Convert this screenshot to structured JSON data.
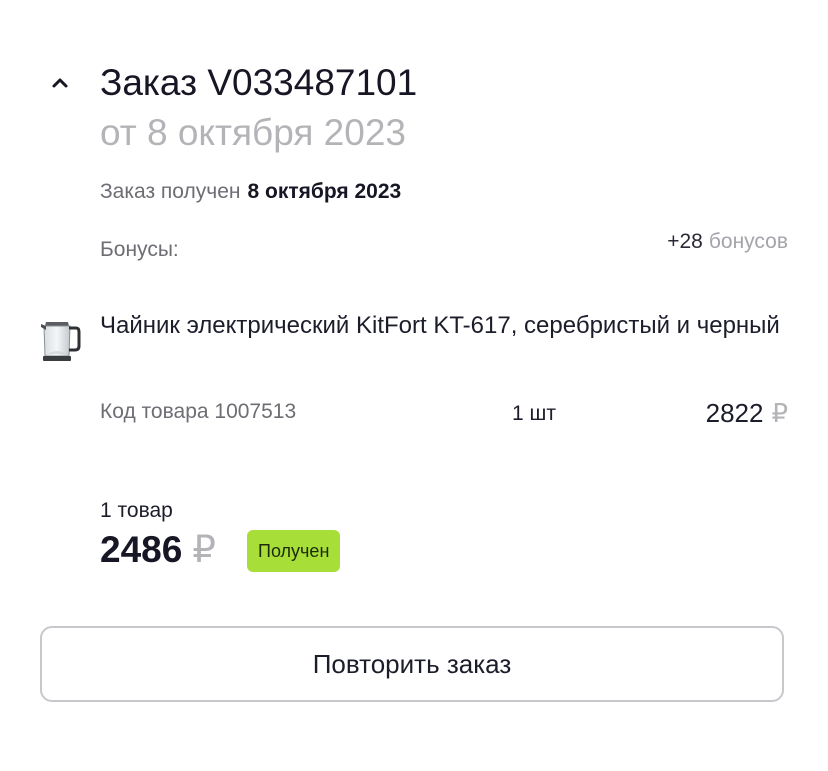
{
  "order": {
    "title": "Заказ V033487101",
    "date": "от 8 октября 2023",
    "received_label": "Заказ получен",
    "received_date": "8 октября 2023",
    "bonus_label": "Бонусы:",
    "bonus_amount": "+28",
    "bonus_unit": "бонусов"
  },
  "item": {
    "name": "Чайник электрический KitFort KT-617, серебристый и черный",
    "code": "Код товара 1007513",
    "quantity": "1 шт",
    "price": "2822",
    "currency": "₽",
    "image_icon": "kettle-icon"
  },
  "summary": {
    "items_count": "1 товар",
    "total": "2486",
    "currency": "₽",
    "status": "Получен",
    "status_color": "#a7df38"
  },
  "actions": {
    "repeat_label": "Повторить заказ"
  },
  "icons": {
    "toggle": "chevron-up-icon"
  }
}
